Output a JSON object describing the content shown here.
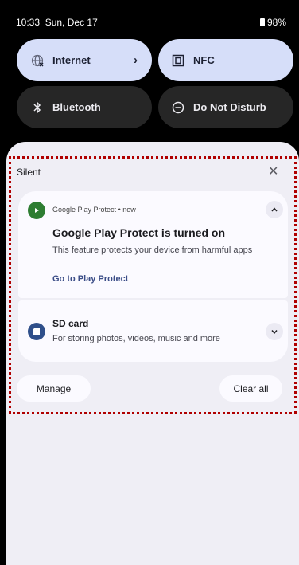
{
  "status_bar": {
    "time": "10:33",
    "date": "Sun, Dec 17",
    "battery": "98%"
  },
  "quick_tiles": {
    "internet": {
      "label": "Internet",
      "icon": "wifi-globe-icon"
    },
    "nfc": {
      "label": "NFC",
      "icon": "nfc-icon"
    },
    "bluetooth": {
      "label": "Bluetooth",
      "icon": "bluetooth-icon"
    },
    "dnd": {
      "label": "Do Not Disturb",
      "icon": "do-not-disturb-icon"
    }
  },
  "notifications": {
    "section_title": "Silent",
    "play_protect": {
      "app_name": "Google Play Protect",
      "separator": "•",
      "time": "now",
      "title": "Google Play Protect is turned on",
      "body": "This feature protects your device from harmful apps",
      "action": "Go to Play Protect"
    },
    "sd_card": {
      "title": "SD card",
      "body": "For storing photos, videos, music and more"
    },
    "manage_label": "Manage",
    "clear_all_label": "Clear all"
  },
  "colors": {
    "tile_active": "#d6def9",
    "tile_inactive": "#262626",
    "shade_bg": "#efeef5",
    "card_bg": "#fbfaff",
    "play_protect_green": "#2e7d32",
    "sd_card_blue": "#2f4f8a",
    "link": "#3b4d87"
  }
}
